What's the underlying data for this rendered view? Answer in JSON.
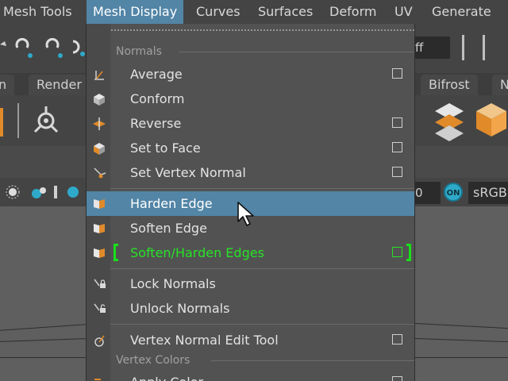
{
  "menubar": {
    "items": [
      "Mesh Tools",
      "Mesh Display",
      "Curves",
      "Surfaces",
      "Deform",
      "UV",
      "Generate"
    ],
    "active": "Mesh Display"
  },
  "shelf": {
    "field_text": "ff",
    "tabs": [
      "n",
      "Render",
      "Bifrost",
      "N"
    ],
    "value_field": "0",
    "on_label": "ON",
    "color_space": "sRGB"
  },
  "menu": {
    "sections": {
      "normals": "Normals",
      "vertex_colors": "Vertex Colors"
    },
    "items": [
      {
        "label": "Average",
        "has_box": true
      },
      {
        "label": "Conform",
        "has_box": false
      },
      {
        "label": "Reverse",
        "has_box": true
      },
      {
        "label": "Set to Face",
        "has_box": true
      },
      {
        "label": "Set Vertex Normal",
        "has_box": true
      },
      {
        "label": "Harden Edge",
        "has_box": false,
        "highlighted": true
      },
      {
        "label": "Soften Edge",
        "has_box": false
      },
      {
        "label": "Soften/Harden Edges",
        "has_box": true,
        "color": "#27e327"
      },
      {
        "label": "Lock Normals",
        "has_box": false
      },
      {
        "label": "Unlock Normals",
        "has_box": false
      },
      {
        "label": "Vertex Normal Edit Tool",
        "has_box": true
      }
    ],
    "partial_item": "Apply Color"
  },
  "colors": {
    "accent": "#5285a6",
    "highlight_green": "#27e327",
    "menubar_bg": "#444444",
    "menu_bg": "#525252"
  }
}
